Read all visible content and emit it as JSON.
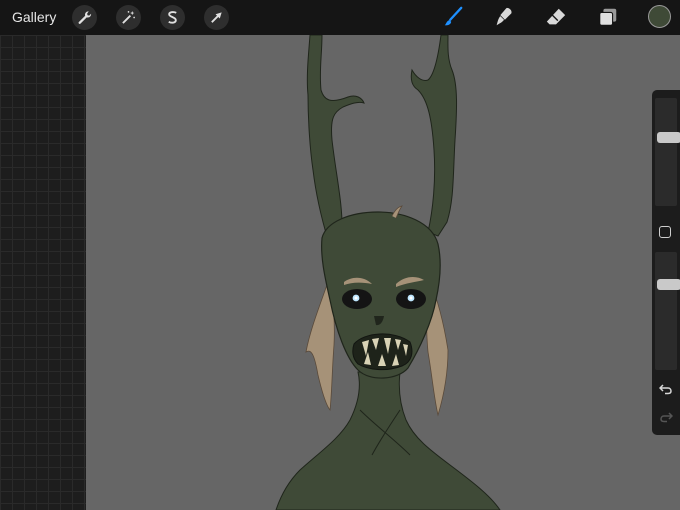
{
  "toolbar": {
    "gallery_label": "Gallery",
    "left_tools": [
      "wrench-icon",
      "magic-wand-icon",
      "selection-s-icon",
      "arrow-transform-icon"
    ],
    "right_tools": [
      "brush-icon",
      "smudge-icon",
      "eraser-icon",
      "layers-icon"
    ],
    "active_tool": "brush",
    "current_color": "#3f4a37",
    "accent_color": "#1e90ff"
  },
  "sidebar": {
    "brush_size_level": 0.35,
    "opacity_level": 0.25,
    "buttons": [
      "modify-square-icon",
      "undo-icon",
      "redo-icon"
    ]
  },
  "canvas": {
    "background_color": "#666666",
    "figure_color": "#3f4a37"
  }
}
